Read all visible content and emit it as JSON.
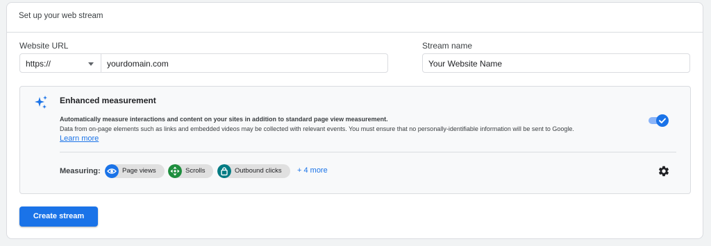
{
  "card": {
    "title": "Set up your web stream"
  },
  "url_field": {
    "label": "Website URL",
    "protocol_value": "https://",
    "url_value": "yourdomain.com"
  },
  "name_field": {
    "label": "Stream name",
    "value": "Your Website Name"
  },
  "enhanced": {
    "title": "Enhanced measurement",
    "desc_bold": "Automatically measure interactions and content on your sites in addition to standard page view measurement.",
    "desc": "Data from on-page elements such as links and embedded videos may be collected with relevant events. You must ensure that no personally-identifiable information will be sent to Google.",
    "learn_more": "Learn more",
    "toggle_on": true,
    "measuring_label": "Measuring:",
    "chips": [
      {
        "label": "Page views",
        "icon": "eye-icon",
        "color": "#1a73e8"
      },
      {
        "label": "Scrolls",
        "icon": "scroll-arrows-icon",
        "color": "#1e8e3e"
      },
      {
        "label": "Outbound clicks",
        "icon": "lock-icon",
        "color": "#007b83"
      }
    ],
    "more_label": "+ 4 more"
  },
  "actions": {
    "create_label": "Create stream"
  },
  "colors": {
    "accent": "#1a73e8",
    "border": "#dadce0",
    "panel_bg": "#f8f9fa"
  }
}
